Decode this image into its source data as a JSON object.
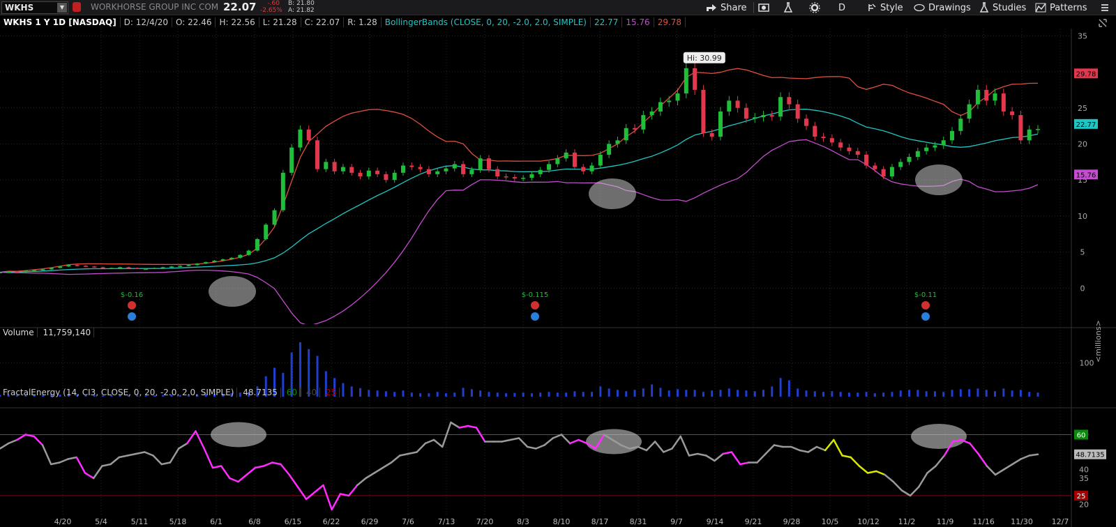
{
  "header": {
    "symbol": "WKHS",
    "company": "WORKHORSE GROUP INC COM",
    "last": "22.07",
    "net_change": "-.60",
    "pct_change": "-2.65%",
    "bid": "B: 21.80",
    "ask": "A: 21.82",
    "share_label": "Share",
    "period_label": "D",
    "style_label": "Style",
    "drawings_label": "Drawings",
    "studies_label": "Studies",
    "patterns_label": "Patterns"
  },
  "study_bar": {
    "title": "WKHS 1 Y 1D [NASDAQ]",
    "date": "D: 12/4/20",
    "open": "O: 22.46",
    "high": "H: 22.56",
    "low": "L: 21.28",
    "close": "C: 22.07",
    "range": "R: 1.28",
    "bb_name": "BollingerBands (CLOSE, 0, 20, -2.0, 2.0, SIMPLE)",
    "bb_mid": "22.77",
    "bb_low": "15.76",
    "bb_up": "29.78"
  },
  "volume_bar": {
    "label": "Volume",
    "value": "11,759,140",
    "axis_label": "<millions>"
  },
  "fe_bar": {
    "name": "FractalEnergy (14, CI3, CLOSE, 0, 20, -2.0, 2.0, SIMPLE)",
    "value": "48.7135",
    "upper": "60",
    "mid": "40",
    "lower": "25"
  },
  "colors": {
    "up": "#1fbf3a",
    "down": "#e2384d",
    "bb_mid": "#1fc7c4",
    "bb_upper": "#e05040",
    "bb_lower": "#c44dd0",
    "volume": "#1f3fcc",
    "fe_gray": "#9a9a9a",
    "fe_magenta": "#ff2bff",
    "fe_yellow": "#d8e800",
    "line_60": "#0a8a0a",
    "line_25": "#a00000"
  },
  "chart_data": {
    "type": "candlestick",
    "title": "WKHS 1 Y 1D [NASDAQ]",
    "price_axis": {
      "ylim": [
        -5,
        36
      ],
      "ticks": [
        0,
        5,
        10,
        15,
        20,
        25,
        30,
        35
      ]
    },
    "x_tick_labels": [
      "4/20",
      "5/4",
      "5/11",
      "5/18",
      "6/1",
      "6/8",
      "6/15",
      "6/22",
      "6/29",
      "7/6",
      "7/13",
      "7/20",
      "8/3",
      "8/10",
      "8/17",
      "8/31",
      "9/7",
      "9/14",
      "9/21",
      "9/28",
      "10/5",
      "10/12",
      "11/2",
      "11/9",
      "11/16",
      "11/30",
      "12/7"
    ],
    "price_badges": [
      {
        "label": "29.78",
        "value": 29.78,
        "color": "#e2384d"
      },
      {
        "label": "22.77",
        "value": 22.77,
        "color": "#1fc7c4"
      },
      {
        "label": "15.76",
        "value": 15.76,
        "color": "#c44dd0"
      }
    ],
    "hi_annotation": "Hi: 30.99",
    "earnings": [
      {
        "label": "$-0.16",
        "x": "5/4"
      },
      {
        "label": "$-0.115",
        "x": "8/10"
      },
      {
        "label": "$-0.11",
        "x": "11/9"
      }
    ],
    "close_series": [
      2.2,
      2.3,
      2.2,
      2.4,
      2.5,
      2.6,
      2.8,
      3.0,
      3.2,
      3.1,
      3.0,
      2.9,
      2.8,
      2.8,
      2.9,
      2.8,
      2.7,
      2.7,
      2.8,
      2.9,
      3.0,
      3.1,
      3.2,
      3.4,
      3.6,
      3.8,
      4.0,
      4.2,
      4.6,
      5.2,
      6.8,
      8.8,
      10.8,
      16.0,
      19.5,
      22.0,
      20.5,
      16.5,
      17.5,
      16.2,
      16.8,
      16.0,
      15.5,
      16.3,
      15.8,
      15.0,
      16.0,
      17.0,
      16.8,
      16.5,
      15.8,
      16.2,
      16.6,
      17.2,
      15.8,
      16.4,
      18.0,
      16.5,
      15.5,
      15.4,
      15.2,
      15.3,
      15.8,
      16.4,
      17.2,
      18.0,
      18.8,
      16.8,
      16.2,
      17.0,
      18.5,
      20.0,
      20.5,
      22.2,
      22.0,
      24.0,
      24.5,
      25.8,
      26.0,
      27.0,
      30.5,
      27.5,
      21.5,
      21.0,
      24.5,
      26.0,
      25.0,
      23.5,
      23.7,
      24.0,
      23.8,
      26.5,
      25.5,
      23.5,
      22.5,
      21.0,
      20.8,
      20.2,
      19.5,
      19.0,
      18.5,
      17.0,
      16.5,
      15.5,
      16.8,
      17.5,
      18.2,
      19.0,
      19.5,
      19.8,
      20.5,
      21.8,
      23.5,
      25.5,
      27.5,
      26.0,
      27.0,
      24.5,
      24.0,
      20.5,
      22.0,
      22.07
    ],
    "bollinger": {
      "middle_end": 22.77,
      "upper_end": 29.78,
      "lower_end": 15.76
    },
    "volume": {
      "unit": "millions",
      "ylim": [
        0,
        160
      ],
      "ticks": [
        100
      ],
      "values": [
        5,
        6,
        5,
        4,
        6,
        5,
        7,
        6,
        8,
        7,
        6,
        5,
        4,
        4,
        5,
        4,
        4,
        3,
        4,
        5,
        6,
        5,
        6,
        6,
        7,
        8,
        9,
        10,
        12,
        14,
        30,
        60,
        85,
        70,
        130,
        170,
        140,
        120,
        75,
        55,
        40,
        30,
        25,
        20,
        18,
        16,
        14,
        18,
        12,
        10,
        10,
        14,
        10,
        12,
        26,
        22,
        18,
        14,
        12,
        10,
        11,
        12,
        10,
        12,
        14,
        12,
        12,
        16,
        14,
        14,
        30,
        24,
        20,
        16,
        20,
        24,
        36,
        26,
        18,
        22,
        20,
        20,
        14,
        18,
        20,
        24,
        20,
        18,
        16,
        20,
        30,
        55,
        48,
        24,
        18,
        16,
        14,
        16,
        14,
        12,
        12,
        14,
        10,
        12,
        14,
        18,
        20,
        20,
        16,
        16,
        14,
        20,
        22,
        22,
        24,
        20,
        16,
        24,
        18,
        20,
        14,
        12
      ]
    },
    "fractal_energy": {
      "ylim": [
        15,
        75
      ],
      "levels": {
        "upper": 60,
        "lower": 25
      },
      "axis_ticks": [
        20,
        35,
        40,
        60
      ],
      "values": [
        52,
        55,
        57,
        60,
        59,
        54,
        43,
        44,
        46,
        47,
        38,
        35,
        42,
        43,
        47,
        48,
        49,
        50,
        48,
        43,
        44,
        52,
        55,
        62,
        52,
        41,
        42,
        35,
        33,
        37,
        41,
        42,
        44,
        43,
        37,
        30,
        23,
        27,
        31,
        17,
        26,
        25,
        31,
        35,
        38,
        41,
        44,
        48,
        49,
        50,
        55,
        57,
        53,
        67,
        64,
        65,
        64,
        56,
        56,
        56,
        57,
        58,
        53,
        52,
        54,
        58,
        60,
        55,
        57,
        55,
        52,
        60,
        57,
        54,
        52,
        53,
        51,
        56,
        50,
        52,
        59,
        48,
        49,
        48,
        45,
        49,
        50,
        43,
        44,
        44,
        49,
        54,
        53,
        53,
        51,
        50,
        53,
        51,
        57,
        48,
        47,
        42,
        38,
        39,
        37,
        33,
        28,
        25,
        30,
        38,
        42,
        48,
        56,
        57,
        55,
        49,
        42,
        37,
        40,
        43,
        46,
        48,
        48.7
      ],
      "colors": [
        "g",
        "g",
        "g",
        "m",
        "m",
        "m",
        "g",
        "g",
        "g",
        "g",
        "m",
        "m",
        "g",
        "g",
        "g",
        "g",
        "g",
        "g",
        "g",
        "g",
        "g",
        "g",
        "g",
        "m",
        "m",
        "m",
        "m",
        "m",
        "m",
        "m",
        "m",
        "m",
        "m",
        "m",
        "m",
        "m",
        "m",
        "m",
        "m",
        "m",
        "m",
        "m",
        "m",
        "g",
        "g",
        "g",
        "g",
        "g",
        "g",
        "g",
        "g",
        "g",
        "g",
        "g",
        "g",
        "m",
        "m",
        "m",
        "g",
        "g",
        "g",
        "g",
        "g",
        "g",
        "g",
        "g",
        "g",
        "g",
        "m",
        "m",
        "m",
        "m",
        "g",
        "g",
        "g",
        "g",
        "g",
        "g",
        "g",
        "g",
        "g",
        "g",
        "g",
        "g",
        "g",
        "g",
        "m",
        "m",
        "m",
        "g",
        "g",
        "g",
        "g",
        "g",
        "g",
        "g",
        "g",
        "g",
        "y",
        "y",
        "y",
        "y",
        "y",
        "y",
        "y",
        "g",
        "g",
        "g",
        "g",
        "g",
        "g",
        "g",
        "m",
        "m",
        "m",
        "m",
        "m",
        "g",
        "g",
        "g",
        "g",
        "g"
      ]
    }
  }
}
